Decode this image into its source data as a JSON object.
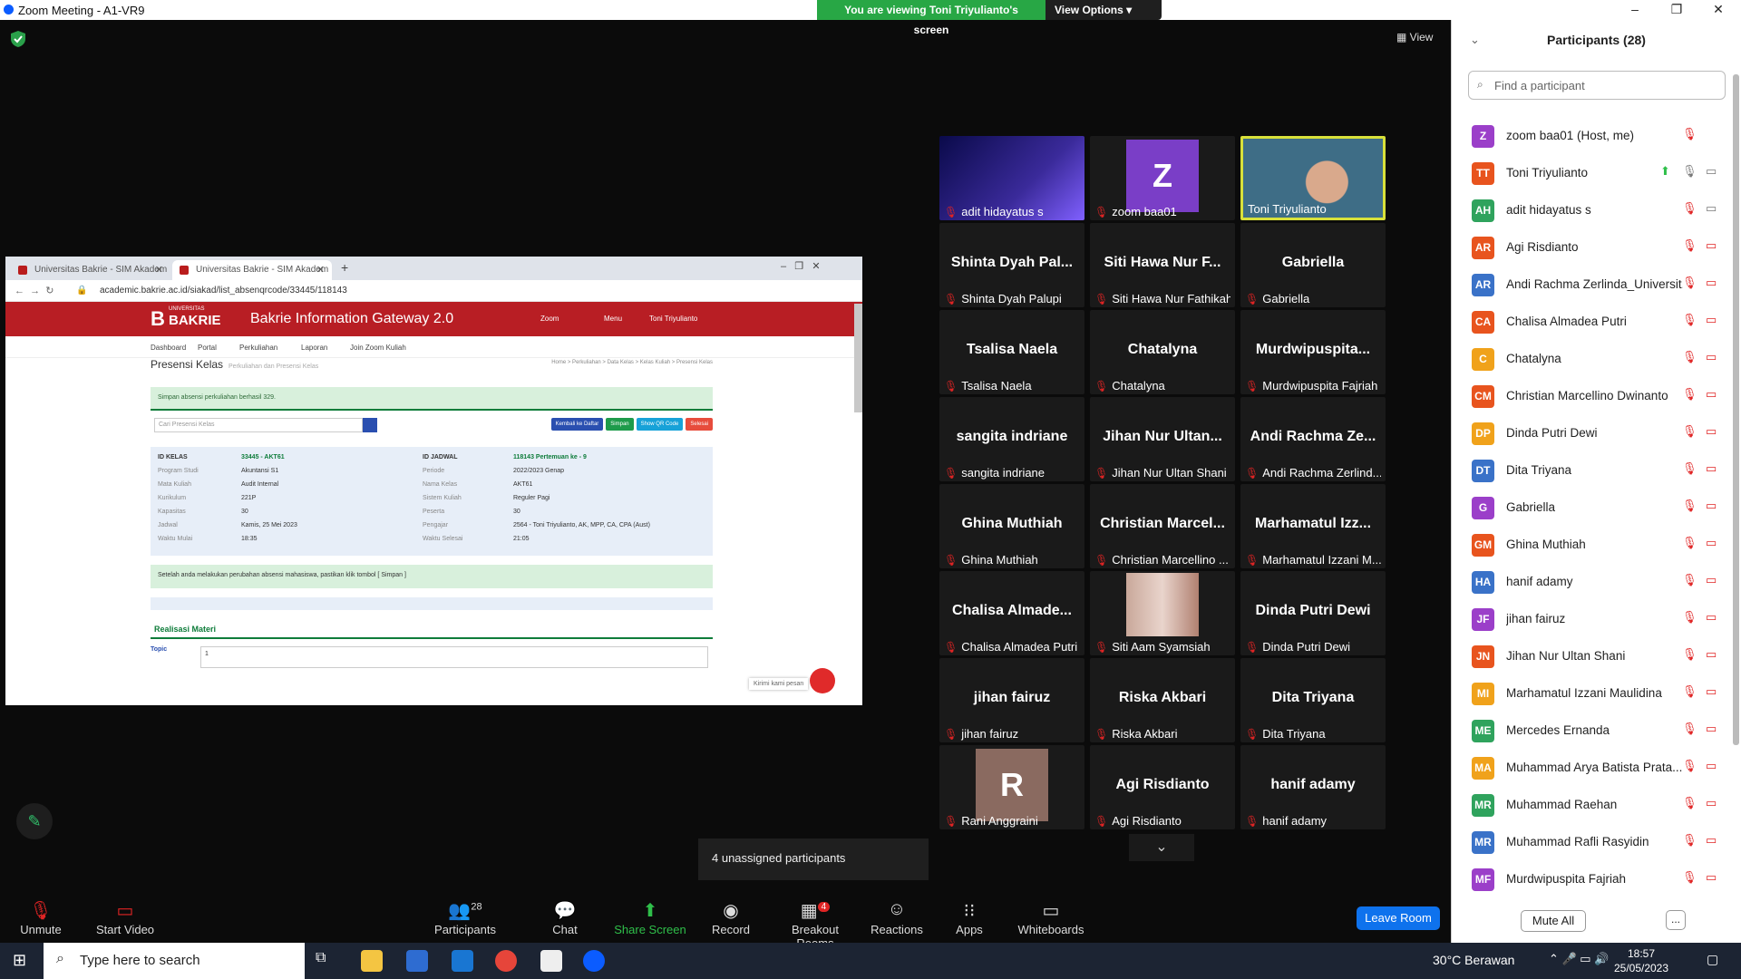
{
  "window": {
    "title": "Zoom Meeting - A1-VR9"
  },
  "share_banner": {
    "message": "You are viewing Toni Triyulianto's screen",
    "options": "View Options"
  },
  "view_label": "View",
  "browser": {
    "tab1": "Universitas Bakrie - SIM Akadem",
    "tab2": "Universitas Bakrie - SIM Akadem",
    "url": "academic.bakrie.ac.id/siakad/list_absenqrcode/33445/118143",
    "site_title": "Bakrie Information Gateway 2.0",
    "logo_text": "BAKRIE",
    "logo_small": "UNIVERSITAS",
    "header_links": [
      "Zoom",
      "Menu",
      "Toni Triyulianto"
    ],
    "nav": [
      "Dashboard",
      "Portal",
      "Perkuliahan",
      "Laporan",
      "Join Zoom Kuliah"
    ],
    "page_title": "Presensi Kelas",
    "page_subtitle": "Perkuliahan dan Presensi Kelas",
    "breadcrumb": "Home > Perkuliahan > Data Kelas > Kelas Kuliah > Presensi Kelas",
    "alert": "Simpan absensi perkuliahan berhasil 329.",
    "search_placeholder": "Cari Presensi Kelas",
    "buttons": [
      "Kembali ke Daftar",
      "Simpan",
      "Show QR Code",
      "Selesai"
    ],
    "info": {
      "left": [
        [
          "ID KELAS",
          "33445 - AKT61"
        ],
        [
          "Program Studi",
          "Akuntansi S1"
        ],
        [
          "Mata Kuliah",
          "Audit Internal"
        ],
        [
          "Kurikulum",
          "221P"
        ],
        [
          "Kapasitas",
          "30"
        ],
        [
          "Jadwal",
          "Kamis, 25 Mei 2023"
        ],
        [
          "Waktu Mulai",
          "18:35"
        ]
      ],
      "right": [
        [
          "ID JADWAL",
          "118143 Pertemuan ke - 9"
        ],
        [
          "Periode",
          "2022/2023 Genap"
        ],
        [
          "Nama Kelas",
          "AKT61"
        ],
        [
          "Sistem Kuliah",
          "Reguler Pagi"
        ],
        [
          "Peserta",
          "30"
        ],
        [
          "Pengajar",
          "2564 - Toni Triyulianto, AK, MPP, CA, CPA (Aust)"
        ],
        [
          "Waktu Selesai",
          "21:05"
        ]
      ]
    },
    "notice": "Setelah anda melakukan perubahan absensi mahasiswa, pastikan klik tombol [ Simpan ]",
    "section": "Realisasi Materi",
    "topic_label": "Topic",
    "topic_value": "1",
    "chat_prompt": "Kirimi kami pesan"
  },
  "gallery": [
    {
      "big": "",
      "name": "adit hidayatus s",
      "video": "adit"
    },
    {
      "big": "Z",
      "name": "zoom baa01",
      "video": "z"
    },
    {
      "big": "",
      "name": "Toni Triyulianto",
      "video": "toni"
    },
    {
      "big": "Shinta Dyah Pal...",
      "name": "Shinta Dyah Palupi"
    },
    {
      "big": "Siti Hawa Nur F...",
      "name": "Siti Hawa Nur Fathikah"
    },
    {
      "big": "Gabriella",
      "name": "Gabriella"
    },
    {
      "big": "Tsalisa Naela",
      "name": "Tsalisa Naela"
    },
    {
      "big": "Chatalyna",
      "name": "Chatalyna"
    },
    {
      "big": "Murdwipuspita...",
      "name": "Murdwipuspita Fajriah"
    },
    {
      "big": "sangita indriane",
      "name": "sangita indriane"
    },
    {
      "big": "Jihan Nur Ultan...",
      "name": "Jihan Nur Ultan Shani"
    },
    {
      "big": "Andi Rachma Ze...",
      "name": "Andi Rachma Zerlind..."
    },
    {
      "big": "Ghina Muthiah",
      "name": "Ghina Muthiah"
    },
    {
      "big": "Christian Marcel...",
      "name": "Christian Marcellino ..."
    },
    {
      "big": "Marhamatul Izz...",
      "name": "Marhamatul Izzani M..."
    },
    {
      "big": "Chalisa Almade...",
      "name": "Chalisa Almadea Putri"
    },
    {
      "big": "",
      "name": "Siti Aam Syamsiah",
      "video": "siti"
    },
    {
      "big": "Dinda Putri Dewi",
      "name": "Dinda Putri Dewi"
    },
    {
      "big": "jihan fairuz",
      "name": "jihan fairuz"
    },
    {
      "big": "Riska Akbari",
      "name": "Riska Akbari"
    },
    {
      "big": "Dita Triyana",
      "name": "Dita Triyana"
    },
    {
      "big": "R",
      "name": "Rani Anggraini",
      "video": "r"
    },
    {
      "big": "Agi Risdianto",
      "name": "Agi Risdianto"
    },
    {
      "big": "hanif adamy",
      "name": "hanif adamy"
    }
  ],
  "participants": {
    "title": "Participants (28)",
    "search_placeholder": "Find a participant",
    "list": [
      {
        "initials": "Z",
        "name": "zoom baa01 (Host, me)",
        "color": "#9b3fc9"
      },
      {
        "initials": "TT",
        "name": "Toni Triyulianto",
        "color": "#e8541e"
      },
      {
        "initials": "AH",
        "name": "adit hidayatus s",
        "color": "#2fa35d"
      },
      {
        "initials": "AR",
        "name": "Agi Risdianto",
        "color": "#e8541e"
      },
      {
        "initials": "AR",
        "name": "Andi Rachma Zerlinda_Universit...",
        "color": "#3a72c8"
      },
      {
        "initials": "CA",
        "name": "Chalisa Almadea Putri",
        "color": "#e8541e"
      },
      {
        "initials": "C",
        "name": "Chatalyna",
        "color": "#f0a21b"
      },
      {
        "initials": "CM",
        "name": "Christian Marcellino Dwinanto",
        "color": "#e8541e"
      },
      {
        "initials": "DP",
        "name": "Dinda Putri Dewi",
        "color": "#f0a21b"
      },
      {
        "initials": "DT",
        "name": "Dita Triyana",
        "color": "#3a72c8"
      },
      {
        "initials": "G",
        "name": "Gabriella",
        "color": "#9b3fc9"
      },
      {
        "initials": "GM",
        "name": "Ghina Muthiah",
        "color": "#e8541e"
      },
      {
        "initials": "HA",
        "name": "hanif adamy",
        "color": "#3a72c8"
      },
      {
        "initials": "JF",
        "name": "jihan fairuz",
        "color": "#9b3fc9"
      },
      {
        "initials": "JN",
        "name": "Jihan Nur Ultan Shani",
        "color": "#e8541e"
      },
      {
        "initials": "MI",
        "name": "Marhamatul Izzani Maulidina",
        "color": "#f0a21b"
      },
      {
        "initials": "ME",
        "name": "Mercedes Ernanda",
        "color": "#2fa35d"
      },
      {
        "initials": "MA",
        "name": "Muhammad Arya Batista Prata...",
        "color": "#f0a21b"
      },
      {
        "initials": "MR",
        "name": "Muhammad Raehan",
        "color": "#2fa35d"
      },
      {
        "initials": "MR",
        "name": "Muhammad Rafli Rasyidin",
        "color": "#3a72c8"
      },
      {
        "initials": "MF",
        "name": "Murdwipuspita Fajriah",
        "color": "#9b3fc9"
      }
    ],
    "mute_all": "Mute All",
    "more": "..."
  },
  "toolbar": {
    "unmute": "Unmute",
    "start_video": "Start Video",
    "participants": "Participants",
    "participants_count": "28",
    "chat": "Chat",
    "share": "Share Screen",
    "record": "Record",
    "breakout": "Breakout Rooms",
    "breakout_badge": "4",
    "reactions": "Reactions",
    "apps": "Apps",
    "whiteboards": "Whiteboards",
    "leave": "Leave Room"
  },
  "unassigned": "4 unassigned participants",
  "taskbar": {
    "search": "Type here to search",
    "weather": "30°C Berawan",
    "time": "18:57",
    "date": "25/05/2023"
  }
}
